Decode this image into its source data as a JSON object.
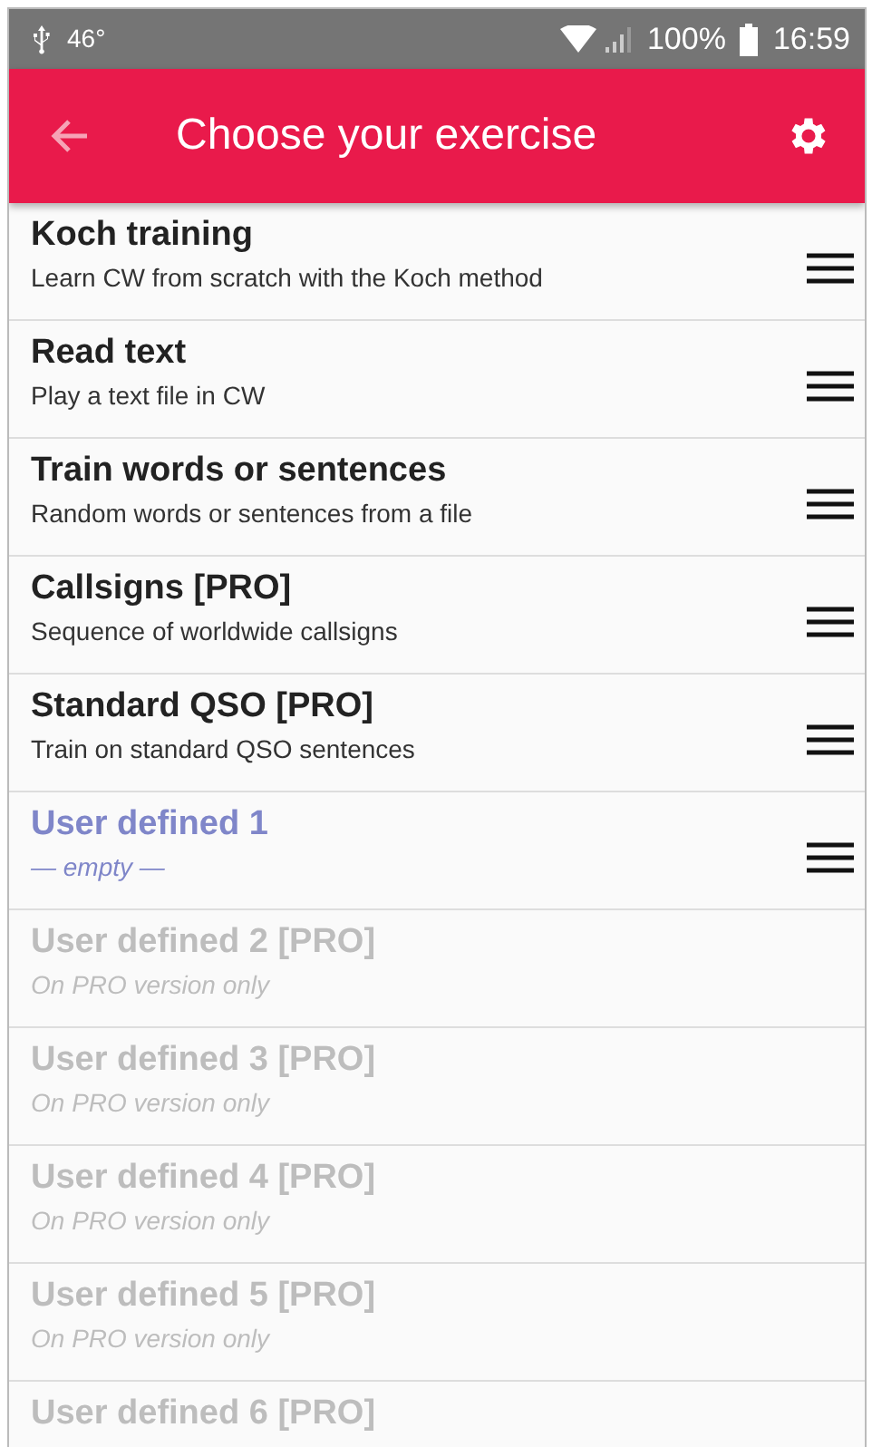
{
  "status_bar": {
    "left_text": "46°",
    "battery": "100%",
    "time": "16:59"
  },
  "app_bar": {
    "title": "Choose your exercise"
  },
  "exercises": [
    {
      "kind": "exercise",
      "title": "Koch training",
      "subtitle": "Learn CW from scratch with the Koch method",
      "disabled": false
    },
    {
      "kind": "exercise",
      "title": "Read text",
      "subtitle": "Play a text file in CW",
      "disabled": false
    },
    {
      "kind": "exercise",
      "title": "Train words or sentences",
      "subtitle": "Random words or sentences from a file",
      "disabled": false
    },
    {
      "kind": "exercise",
      "title": "Callsigns [PRO]",
      "subtitle": "Sequence of worldwide callsigns",
      "disabled": false
    },
    {
      "kind": "exercise",
      "title": "Standard QSO [PRO]",
      "subtitle": "Train on standard QSO sentences",
      "disabled": false
    },
    {
      "kind": "user",
      "title": "User defined 1",
      "subtitle": "— empty —",
      "disabled": false
    },
    {
      "kind": "user",
      "title": "User defined 2 [PRO]",
      "subtitle": "On PRO version only",
      "disabled": true
    },
    {
      "kind": "user",
      "title": "User defined 3 [PRO]",
      "subtitle": "On PRO version only",
      "disabled": true
    },
    {
      "kind": "user",
      "title": "User defined 4 [PRO]",
      "subtitle": "On PRO version only",
      "disabled": true
    },
    {
      "kind": "user",
      "title": "User defined 5 [PRO]",
      "subtitle": "On PRO version only",
      "disabled": true
    },
    {
      "kind": "user",
      "title": "User defined 6 [PRO]",
      "disabled": true
    }
  ]
}
